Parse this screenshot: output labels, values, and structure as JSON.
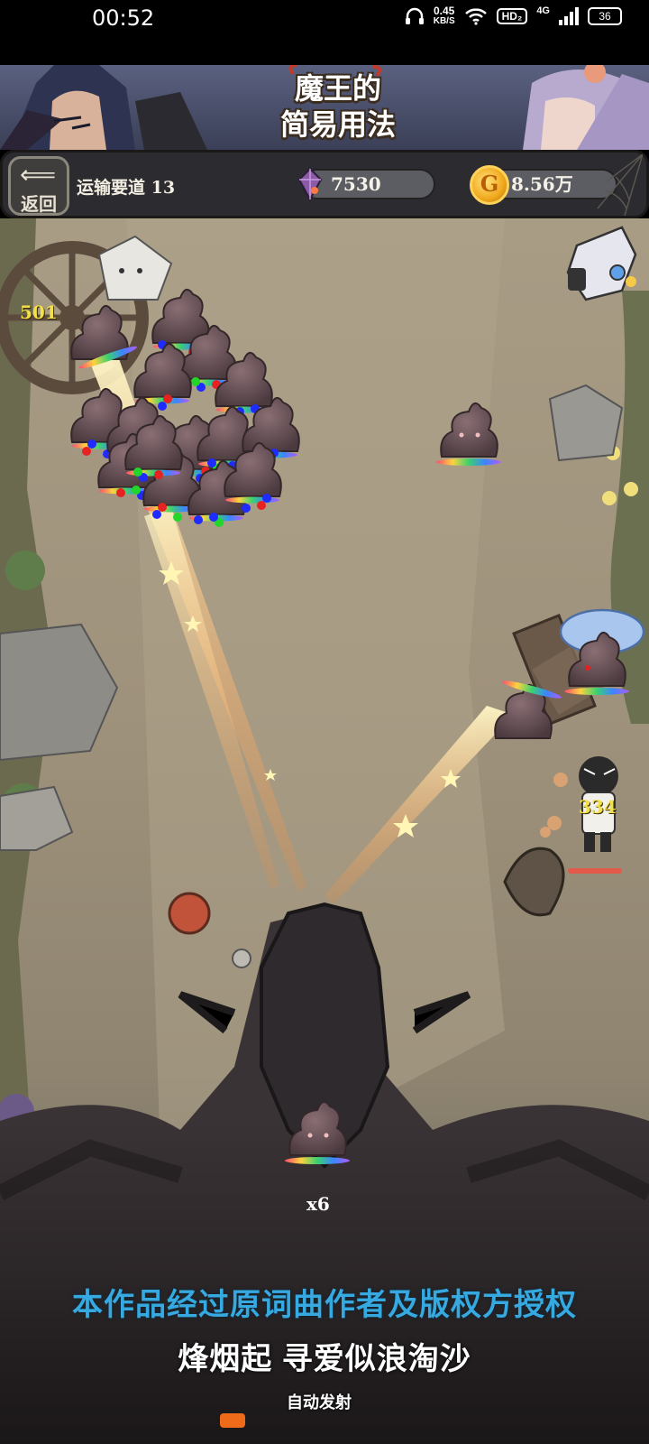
{
  "status_bar": {
    "time": "00:52",
    "net_speed_value": "0.45",
    "net_speed_unit": "KB/S",
    "hd_badge": "HD₂",
    "signal": "4G",
    "battery": "36"
  },
  "banner": {
    "title_line1": "魔王的",
    "title_line2": "简易用法"
  },
  "hud": {
    "back_label": "返回",
    "stage_label": "运输要道 13",
    "gems": "7530",
    "coins": "8.56万"
  },
  "field": {
    "damage_left": "501",
    "damage_right": "334",
    "multiplier": "x6"
  },
  "lyrics": {
    "line1": "本作品经过原词曲作者及版权方授权",
    "line2": "烽烟起 寻爱似浪淘沙"
  },
  "controls": {
    "auto_fire_label": "自动发射",
    "auto_fire_color": "#ef6a19"
  },
  "colors": {
    "lyric_blue": "#36a9e0",
    "damage_yellow": "#f2e04b"
  }
}
